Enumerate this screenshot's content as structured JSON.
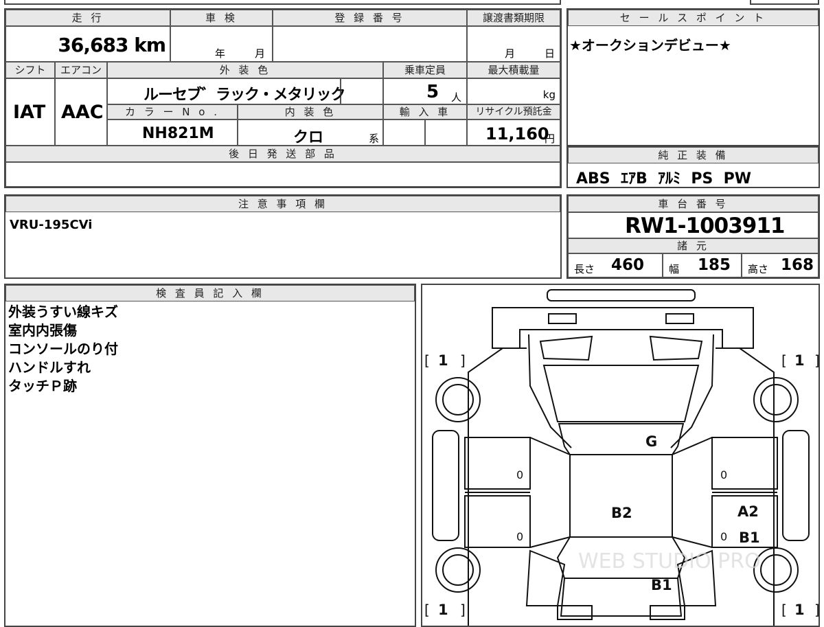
{
  "top": {
    "mileage_label": "走 行",
    "mileage_value": "36,683 km",
    "inspection_label": "車 検",
    "inspection_year": "年",
    "inspection_month": "月",
    "reg_label": "登 録 番 号",
    "transfer_label": "譲渡書類期限",
    "transfer_month": "月",
    "transfer_day": "日"
  },
  "sales": {
    "label": "セ ー ル ス ポ イ ン ト",
    "text": "★オークションデビュー★"
  },
  "row2": {
    "shift_label": "シフト",
    "shift_value": "IAT",
    "ac_label": "エアコン",
    "ac_value": "AAC",
    "exterior_label": "外 装 色",
    "exterior_value": "ルーセブ゛ラック・メタリック",
    "seats_label": "乗車定員",
    "seats_value": "5",
    "seats_unit": "人",
    "load_label": "最大積載量",
    "load_unit": "kg",
    "colorno_label": "カ ラ ー N o .",
    "colorno_value": "NH821M",
    "interior_label": "内 装 色",
    "interior_value": "クロ",
    "interior_suffix": "系",
    "import_label": "輸 入 車",
    "recycle_label": "リサイクル預託金",
    "recycle_value": "11,160",
    "recycle_unit": "円"
  },
  "later_parts": {
    "label": "後 日 発 送 部 品"
  },
  "equipment": {
    "label": "純 正 装 備",
    "value": "ABS  ｴｱB  ｱﾙﾐ  PS  PW"
  },
  "notes": {
    "label": "注 意 事 項 欄",
    "value": "VRU-195CVi"
  },
  "chassis": {
    "label": "車 台 番 号",
    "value": "RW1-1003911",
    "spec_label": "諸 元",
    "length_label": "長さ",
    "length_value": "460",
    "width_label": "幅",
    "width_value": "185",
    "height_label": "高さ",
    "height_value": "168"
  },
  "inspector": {
    "label": "検 査 員 記 入 欄",
    "lines": [
      "外装うすい線キズ",
      "室内内張傷",
      "コンソールのり付",
      "ハンドルすれ",
      "タッチＰ跡"
    ]
  },
  "diagram": {
    "tire_fl": "1",
    "tire_fr": "1",
    "tire_rl": "1",
    "tire_rr": "1",
    "roof": "G",
    "center": "B2",
    "right_rear_a": "A2",
    "right_rear_b": "B1",
    "rear": "B1",
    "door_zero": "0",
    "watermark": "WEB STUDIO PRO"
  }
}
